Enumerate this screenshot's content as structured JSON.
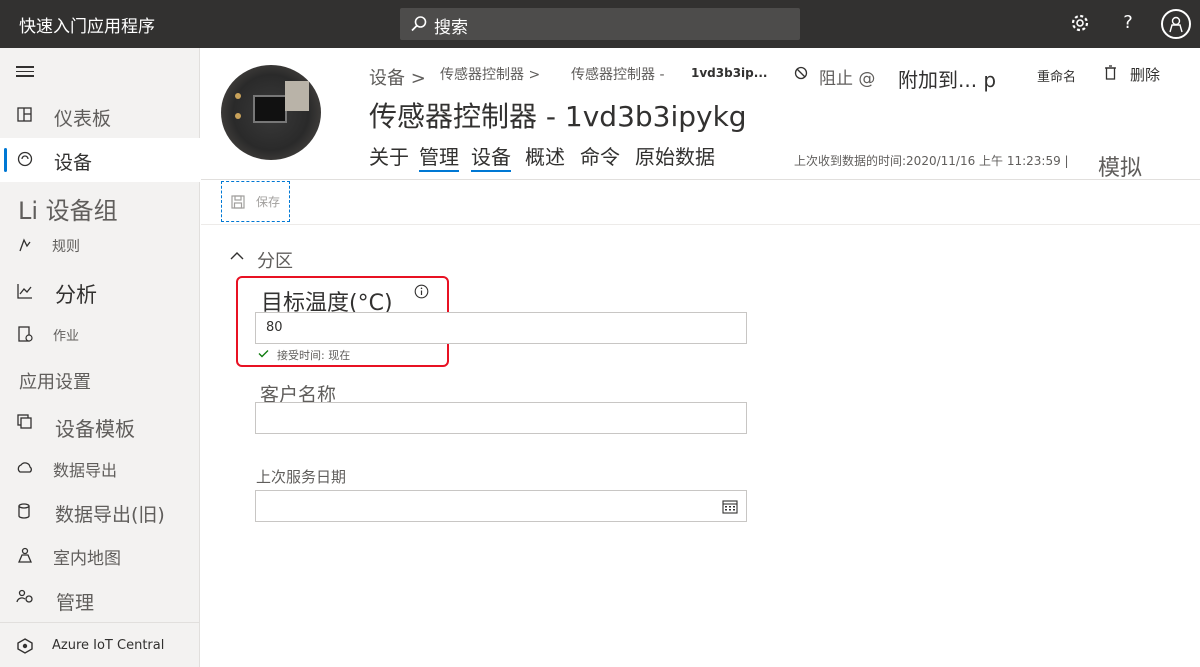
{
  "app": {
    "title": "快速入门应用程序"
  },
  "search": {
    "placeholder": "搜索"
  },
  "topbar": {
    "settings_icon": "gear-icon",
    "help_label": "?",
    "account_icon": "avatar-icon"
  },
  "sidebar": {
    "items": [
      {
        "label": "仪表板",
        "icon": "dashboard-icon"
      },
      {
        "label": "设备",
        "icon": "devices-icon",
        "active": true
      },
      {
        "label": "Li 设备组",
        "icon": ""
      },
      {
        "label": "规则",
        "icon": "rules-icon"
      },
      {
        "label": "分析",
        "icon": "analytics-icon"
      },
      {
        "label": "作业",
        "icon": "jobs-icon"
      },
      {
        "label": "应用设置",
        "icon": ""
      },
      {
        "label": "设备模板",
        "icon": "device-templates-icon"
      },
      {
        "label": "数据导出",
        "icon": "data-export-icon"
      },
      {
        "label": "数据导出(旧)",
        "icon": "data-export-legacy-icon"
      },
      {
        "label": "室内地图",
        "icon": "indoor-maps-icon"
      },
      {
        "label": "管理",
        "icon": "administration-icon"
      }
    ],
    "footer": "Azure IoT Central"
  },
  "breadcrumb": {
    "items": [
      "设备 >",
      "传感器控制器 >",
      "传感器控制器 -",
      "1vd3b3ip..."
    ]
  },
  "commands": {
    "block": "阻止 @",
    "attach": "附加到... p",
    "rename": "重命名",
    "delete": "删除"
  },
  "device": {
    "title": "传感器控制器 - 1vd3b3ipykg",
    "last_data": "上次收到数据的时间:2020/11/16 上午 11:23:59 |",
    "simulate": "模拟"
  },
  "tabs": [
    "关于",
    "管理",
    "设备",
    "概述",
    "命令",
    "原始数据"
  ],
  "toolbar": {
    "save_label": "保存"
  },
  "form": {
    "section": "分区",
    "target_temp_label": "目标温度(°C)",
    "target_temp_value": "80",
    "accepted_text": "接受时间: 现在",
    "customer_name_label": "客户名称",
    "customer_name_value": "",
    "last_service_label": "上次服务日期",
    "last_service_value": ""
  },
  "colors": {
    "topbar": "#323130",
    "accent": "#0078d4",
    "highlight": "#e81123",
    "sidebar": "#f3f2f1"
  }
}
